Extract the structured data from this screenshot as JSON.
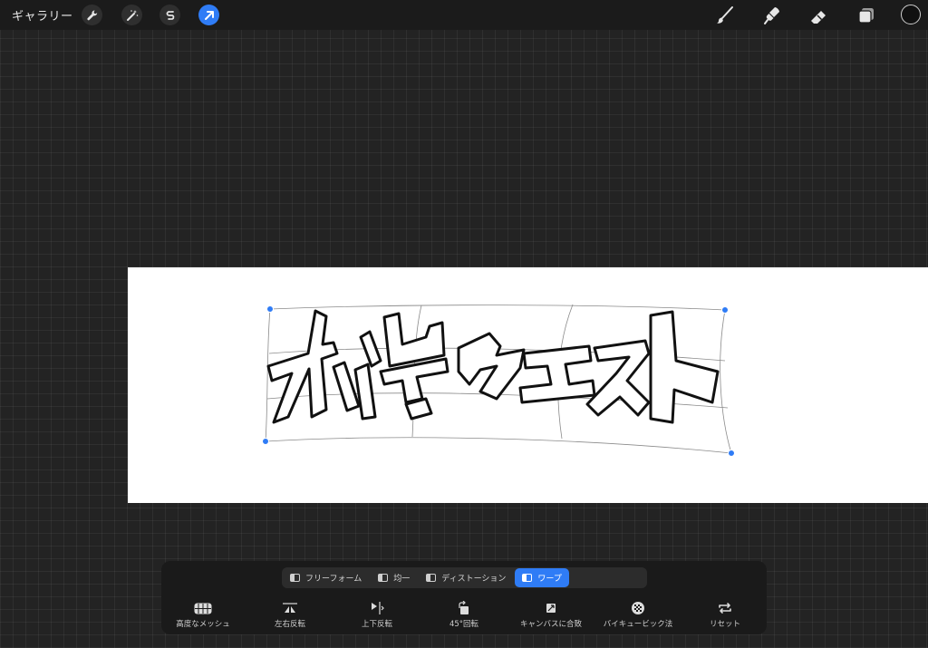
{
  "topbar": {
    "gallery_label": "ギャラリー",
    "left_tools": [
      "wrench-icon",
      "magic-wand-icon",
      "selection-s-icon",
      "transform-arrow-icon"
    ],
    "right_tools": [
      "brush-icon",
      "smudge-icon",
      "eraser-icon",
      "layers-icon"
    ],
    "color": "#111111",
    "accent": "#2f7cf6"
  },
  "artwork": {
    "text": "ホ端クエスト"
  },
  "transform_panel": {
    "modes": [
      {
        "label": "フリーフォーム",
        "active": false
      },
      {
        "label": "均一",
        "active": false
      },
      {
        "label": "ディストーション",
        "active": false
      },
      {
        "label": "ワープ",
        "active": true
      }
    ],
    "actions": [
      {
        "label": "高度なメッシュ",
        "icon": "mesh-icon"
      },
      {
        "label": "左右反転",
        "icon": "flip-horizontal-icon"
      },
      {
        "label": "上下反転",
        "icon": "flip-vertical-icon"
      },
      {
        "label": "45°回転",
        "icon": "rotate-45-icon"
      },
      {
        "label": "キャンバスに合致",
        "icon": "fit-canvas-icon"
      },
      {
        "label": "バイキュービック法",
        "icon": "bicubic-icon"
      },
      {
        "label": "リセット",
        "icon": "reset-icon"
      }
    ]
  }
}
